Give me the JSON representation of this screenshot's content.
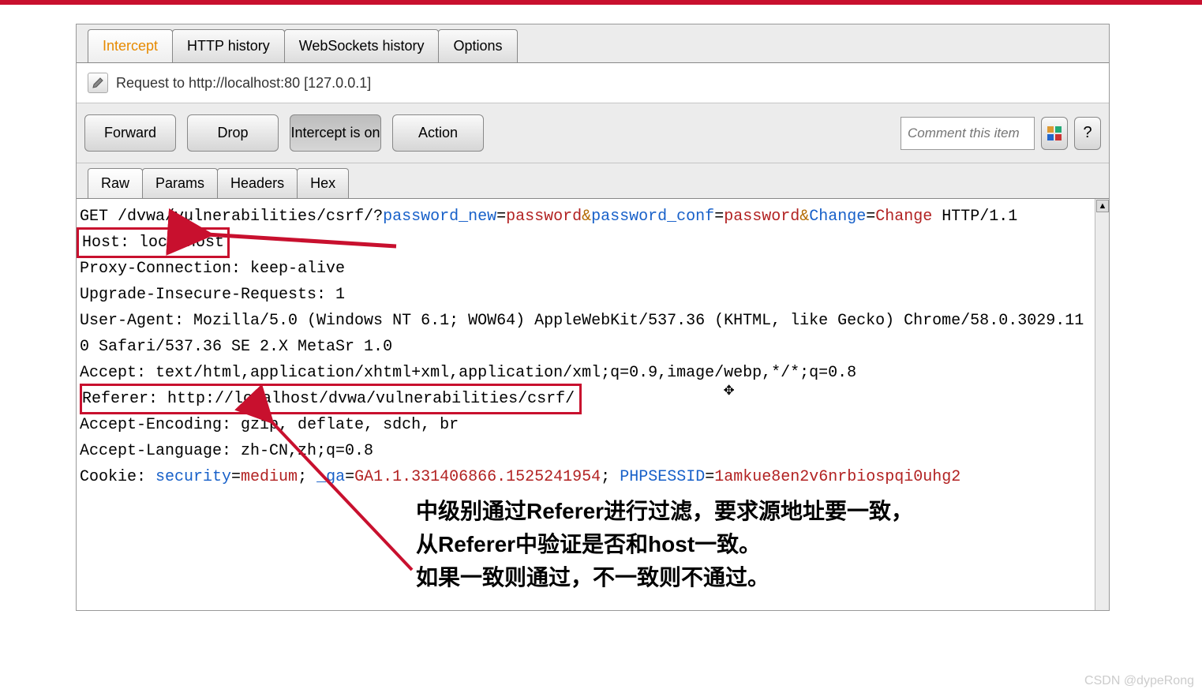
{
  "tabs": {
    "intercept": "Intercept",
    "history": "HTTP history",
    "ws": "WebSockets history",
    "options": "Options"
  },
  "request_line": "Request to http://localhost:80  [127.0.0.1]",
  "buttons": {
    "forward": "Forward",
    "drop": "Drop",
    "toggle": "Intercept is on",
    "action": "Action"
  },
  "comment_placeholder": "Comment this item",
  "help": "?",
  "subtabs": {
    "raw": "Raw",
    "params": "Params",
    "headers": "Headers",
    "hex": "Hex"
  },
  "raw": {
    "method": "GET ",
    "path": "/dvwa/vulnerabilities/csrf/?",
    "p1": "password_new",
    "eq": "=",
    "v1": "password",
    "amp": "&",
    "p2": "password_conf",
    "v2": "password",
    "p3": "Change",
    "v3": "Change",
    "httpver": " HTTP/1.1",
    "host": "Host: localhost",
    "proxy": "Proxy-Connection: keep-alive",
    "upgrade": "Upgrade-Insecure-Requests: 1",
    "ua": "User-Agent: Mozilla/5.0 (Windows NT 6.1; WOW64) AppleWebKit/537.36 (KHTML, like Gecko) Chrome/58.0.3029.110 Safari/537.36 SE 2.X MetaSr 1.0",
    "accept": "Accept: text/html,application/xhtml+xml,application/xml;q=0.9,image/webp,*/*;q=0.8",
    "referer": "Referer: http://localhost/dvwa/vulnerabilities/csrf/",
    "acceptenc": "Accept-Encoding: gzip, deflate, sdch, br",
    "acceptlang": "Accept-Language: zh-CN,zh;q=0.8",
    "cookie_pre": "Cookie: ",
    "ck1": "security",
    "ck1v": "medium",
    "sep": "; ",
    "ck2": "_ga",
    "ck2v": "GA1.1.331406866.1525241954",
    "ck3": "PHPSESSID",
    "ck3v": "1amkue8en2v6nrbiospqi0uhg2"
  },
  "annotation": "中级别通过Referer进行过滤，要求源地址要一致，\n从Referer中验证是否和host一致。\n如果一致则通过，不一致则不通过。",
  "watermark": "CSDN @dypeRong"
}
